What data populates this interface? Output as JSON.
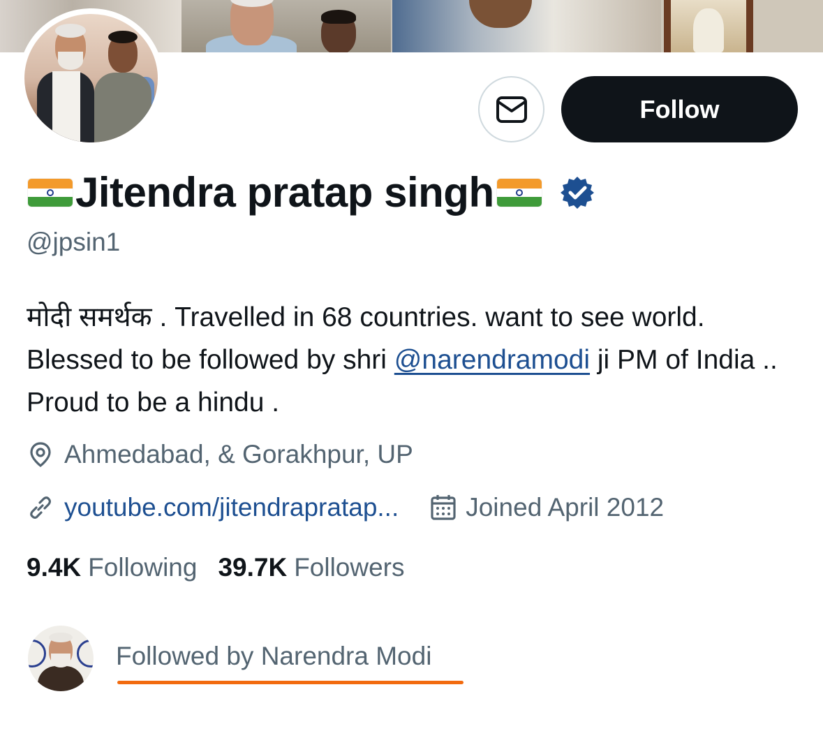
{
  "profile": {
    "name": "Jitendra pratap singh",
    "handle": "@jpsin1",
    "bio_before_mention": "मोदी समर्थक . Travelled in 68 countries. want to see world. Blessed to be followed by shri ",
    "bio_mention": "@narendramodi",
    "bio_after_mention": " ji PM of India .. Proud to be a hindu .",
    "location": "Ahmedabad, & Gorakhpur, UP",
    "website": "youtube.com/jitendrapratap...",
    "joined": "Joined April 2012"
  },
  "buttons": {
    "follow_label": "Follow",
    "message_icon": "envelope-icon"
  },
  "stats": {
    "following_count": "9.4K",
    "following_label": "Following",
    "followers_count": "39.7K",
    "followers_label": "Followers"
  },
  "followed_by": {
    "text": "Followed by Narendra Modi",
    "highlight_color": "#f26b0f"
  },
  "colors": {
    "text_primary": "#0f1419",
    "text_secondary": "#536471",
    "link": "#1d4f91",
    "verified_badge": "#1d4f91",
    "follow_button_bg": "#0f1419"
  },
  "icons": {
    "verified": "verified-badge-icon",
    "location": "location-pin-icon",
    "link": "link-icon",
    "calendar": "calendar-icon",
    "flag": "india-flag-icon"
  }
}
